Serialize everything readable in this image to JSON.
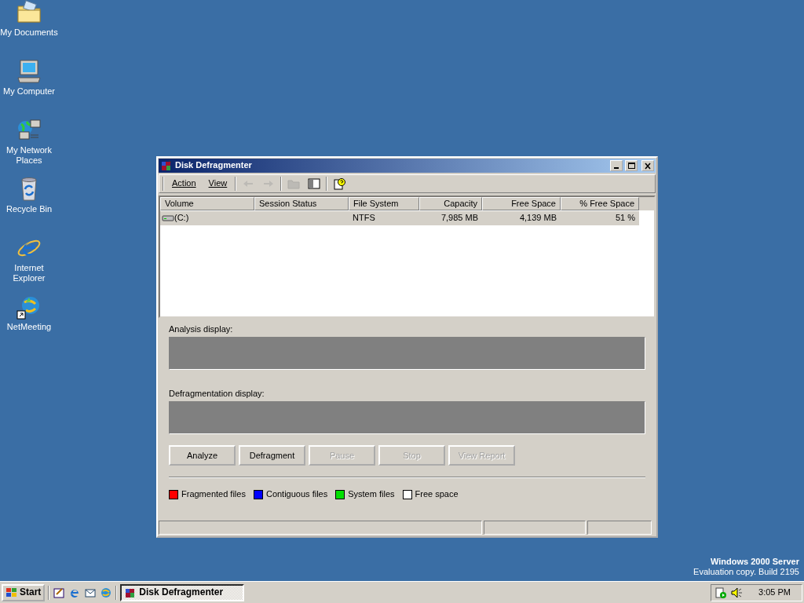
{
  "desktop_icons": [
    {
      "label": "My Documents",
      "kind": "folder"
    },
    {
      "label": "My Computer",
      "kind": "computer"
    },
    {
      "label": "My Network Places",
      "kind": "network"
    },
    {
      "label": "Recycle Bin",
      "kind": "bin"
    },
    {
      "label": "Internet Explorer",
      "kind": "ie"
    },
    {
      "label": "NetMeeting",
      "kind": "netmeeting"
    }
  ],
  "window": {
    "title": "Disk Defragmenter",
    "menu": [
      "Action",
      "View"
    ],
    "toolbar": [
      {
        "kind": "back",
        "disabled": true
      },
      {
        "kind": "forward",
        "disabled": true
      },
      {
        "kind": "folder",
        "disabled": true
      },
      {
        "kind": "panel",
        "disabled": false
      },
      {
        "kind": "help",
        "disabled": false
      }
    ],
    "columns": [
      "Volume",
      "Session Status",
      "File System",
      "Capacity",
      "Free Space",
      "% Free Space"
    ],
    "rows": [
      {
        "volume": "(C:)",
        "session_status": "",
        "file_system": "NTFS",
        "capacity": "7,985 MB",
        "free_space": "4,139 MB",
        "percent_free": "51 %",
        "selected": true
      }
    ],
    "analysis_label": "Analysis display:",
    "defrag_label": "Defragmentation display:",
    "buttons": [
      {
        "label": "Analyze",
        "disabled": false
      },
      {
        "label": "Defragment",
        "disabled": false
      },
      {
        "label": "Pause",
        "disabled": true
      },
      {
        "label": "Stop",
        "disabled": true
      },
      {
        "label": "View Report",
        "disabled": true
      }
    ],
    "legend": [
      {
        "label": "Fragmented files",
        "color": "#ff0000"
      },
      {
        "label": "Contiguous files",
        "color": "#0000ff"
      },
      {
        "label": "System files",
        "color": "#00e000"
      },
      {
        "label": "Free space",
        "color": "#ffffff"
      }
    ]
  },
  "os_notice": [
    "Windows 2000 Server",
    "Evaluation copy. Build 2195"
  ],
  "taskbar": {
    "start": "Start",
    "tasks": [
      {
        "label": "Disk Defragmenter",
        "selected": true
      }
    ],
    "clock": "3:05 PM"
  }
}
